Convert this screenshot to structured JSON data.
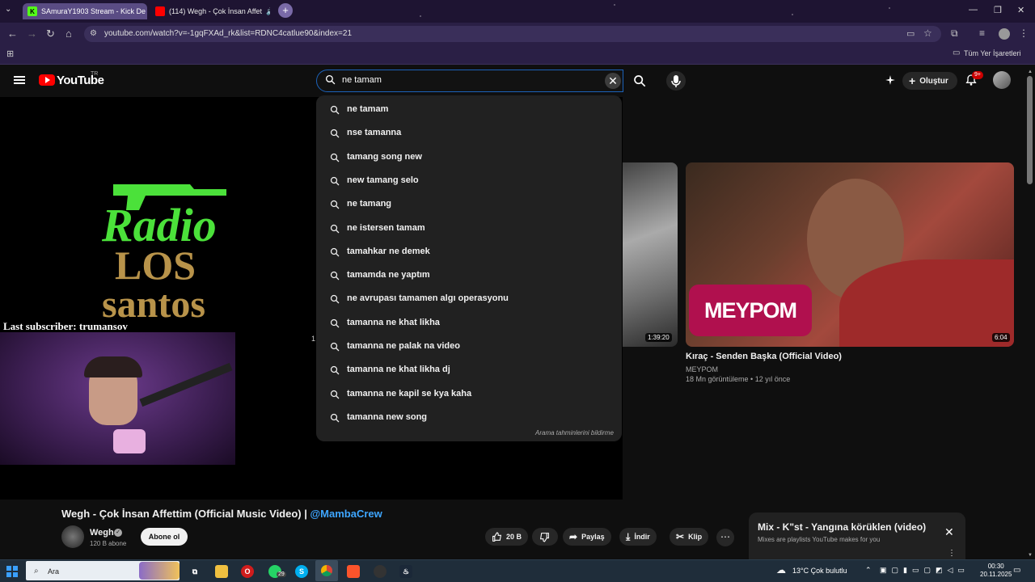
{
  "browser": {
    "tabs": [
      {
        "title": "SAmuraY1903 Stream - Kick De",
        "favicon_letter": "K",
        "favicon_color": "#53fc18"
      },
      {
        "title": "(114) Wegh - Çok İnsan Affet",
        "favicon_color": "#ff0000"
      }
    ],
    "url": "youtube.com/watch?v=-1gqFXAd_rk&list=RDNC4catlue90&index=21",
    "bookmarks_all": "Tüm Yer İşaretleri"
  },
  "youtube": {
    "logo_text": "YouTube",
    "country": "TR",
    "search_value": "ne tamam",
    "create_label": "Oluştur",
    "notif_count": "9+"
  },
  "suggestions": [
    {
      "label": "ne tamam"
    },
    {
      "label": "nse tamanna"
    },
    {
      "label": "tamang song new"
    },
    {
      "label": "new tamang selo"
    },
    {
      "label": "ne tamang"
    },
    {
      "label": "ne istersen tamam"
    },
    {
      "label": "tamahkar ne demek"
    },
    {
      "label": "tamamda ne yaptım"
    },
    {
      "label": "ne avrupası tamamen algı operasyonu"
    },
    {
      "label": "tamanna ne khat likha"
    },
    {
      "label": "tamanna ne palak na video"
    },
    {
      "label": "tamanna ne khat likha dj"
    },
    {
      "label": "tamanna ne kapil se kya kaha"
    },
    {
      "label": "tamanna new song"
    }
  ],
  "suggestions_report": "Arama tahminlerini bildirme",
  "stream_overlay": {
    "last_subscriber": "Last subscriber: trumansov",
    "logo_line1": "Radio",
    "logo_line2": "LOS",
    "logo_line3": "santos",
    "stray_text": "1"
  },
  "recommended": {
    "left_duration": "1:39:20",
    "right": {
      "badge": "MEYPOM",
      "duration": "6:04",
      "title": "Kıraç - Senden Başka (Official Video)",
      "channel": "MEYPOM",
      "meta": "18 Mn görüntüleme • 12 yıl önce"
    }
  },
  "video": {
    "title": "Wegh - Çok İnsan Affettim (Official Music Video) | ",
    "title_link": "@MambaCrew",
    "channel": "Wegh",
    "subs": "120 B abone",
    "subscribe": "Abone ol",
    "likes": "20 B",
    "share": "Paylaş",
    "download": "İndir",
    "clip": "Klip"
  },
  "mix": {
    "title": "Mix - K\"st - Yangına körüklen (video)",
    "subtitle": "Mixes are playlists YouTube makes for you"
  },
  "taskbar": {
    "search_text": "Ara",
    "weather": "13°C  Çok bulutlu",
    "time": "00:30",
    "date": "20.11.2025",
    "chat_badge": "29"
  }
}
